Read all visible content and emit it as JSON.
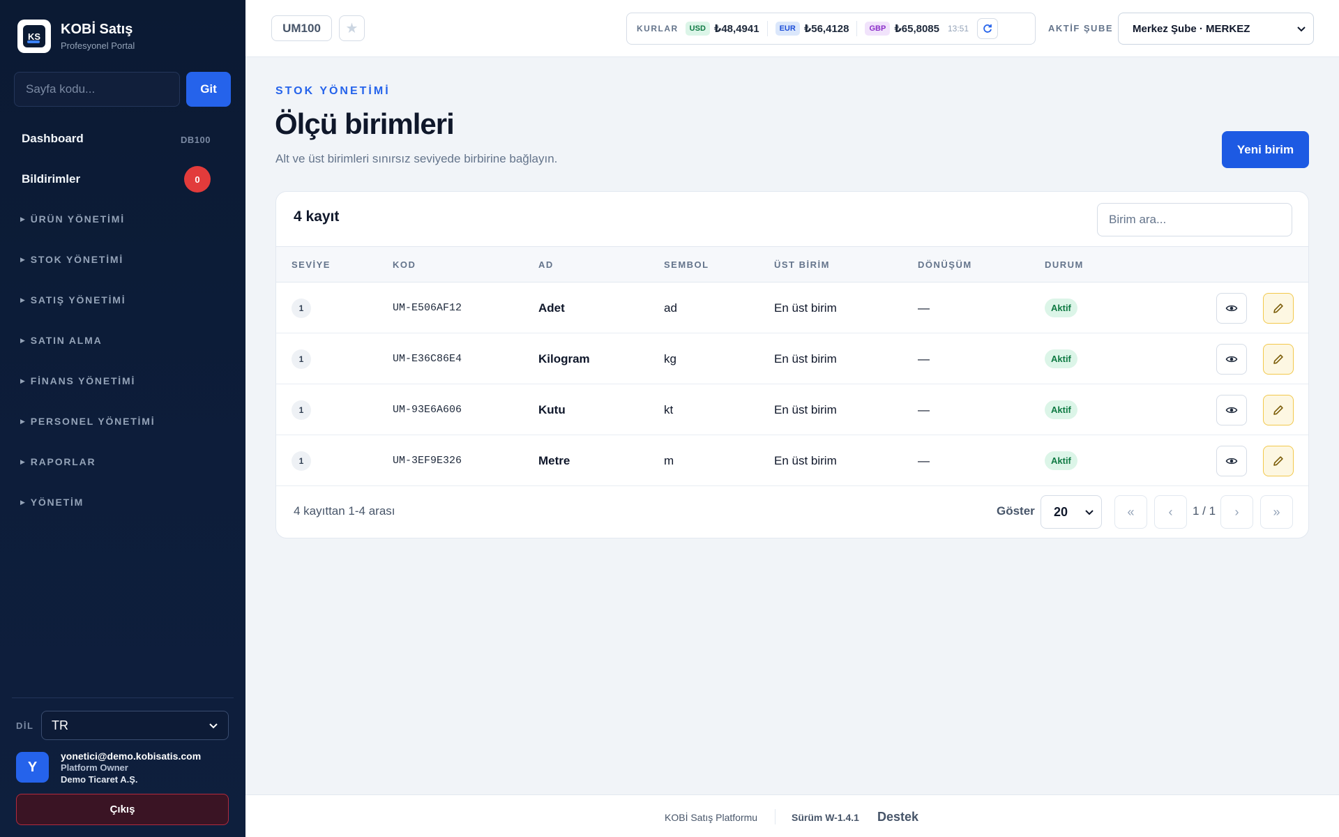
{
  "brand": {
    "title": "KOBİ Satış",
    "subtitle": "Profesyonel Portal"
  },
  "sidebar": {
    "page_code_placeholder": "Sayfa kodu...",
    "go_label": "Git",
    "dashboard": {
      "label": "Dashboard",
      "code": "DB100"
    },
    "notifications": {
      "label": "Bildirimler",
      "count": "0"
    },
    "groups": [
      "ÜRÜN YÖNETİMİ",
      "STOK YÖNETİMİ",
      "SATIŞ YÖNETİMİ",
      "SATIN ALMA",
      "FİNANS YÖNETİMİ",
      "PERSONEL YÖNETİMİ",
      "RAPORLAR",
      "YÖNETİM"
    ],
    "lang_label": "DİL",
    "lang_value": "TR",
    "user": {
      "initial": "Y",
      "email": "yonetici@demo.kobisatis.com",
      "role": "Platform Owner",
      "company": "Demo Ticaret A.Ş."
    },
    "logout_label": "Çıkış"
  },
  "topbar": {
    "page_code": "UM100",
    "rates_label": "KURLAR",
    "rates": [
      {
        "code": "USD",
        "value": "₺48,4941",
        "bg": "#dcf5e8",
        "fg": "#0f7a43"
      },
      {
        "code": "EUR",
        "value": "₺56,4128",
        "bg": "#dbe7fb",
        "fg": "#1d4ed8"
      },
      {
        "code": "GBP",
        "value": "₺65,8085",
        "bg": "#f1e3fb",
        "fg": "#8b2fc9"
      }
    ],
    "rates_time": "13:51",
    "branch_label": "AKTİF ŞUBE",
    "branch_value": "Merkez Şube · MERKEZ"
  },
  "header": {
    "eyebrow": "STOK YÖNETİMİ",
    "title": "Ölçü birimleri",
    "subtitle": "Alt ve üst birimleri sınırsız seviyede birbirine bağlayın.",
    "new_button": "Yeni birim"
  },
  "table": {
    "count_label": "4 kayıt",
    "search_placeholder": "Birim ara...",
    "columns": [
      "SEVİYE",
      "KOD",
      "AD",
      "SEMBOL",
      "ÜST BİRİM",
      "DÖNÜŞÜM",
      "DURUM"
    ],
    "rows": [
      {
        "level": "1",
        "code": "UM-E506AF12",
        "name": "Adet",
        "symbol": "ad",
        "parent": "En üst birim",
        "conversion": "—",
        "status": "Aktif"
      },
      {
        "level": "1",
        "code": "UM-E36C86E4",
        "name": "Kilogram",
        "symbol": "kg",
        "parent": "En üst birim",
        "conversion": "—",
        "status": "Aktif"
      },
      {
        "level": "1",
        "code": "UM-93E6A606",
        "name": "Kutu",
        "symbol": "kt",
        "parent": "En üst birim",
        "conversion": "—",
        "status": "Aktif"
      },
      {
        "level": "1",
        "code": "UM-3EF9E326",
        "name": "Metre",
        "symbol": "m",
        "parent": "En üst birim",
        "conversion": "—",
        "status": "Aktif"
      }
    ],
    "range_label": "4 kayıttan 1-4 arası",
    "show_label": "Göster",
    "page_size": "20",
    "page_info": "1 / 1",
    "pager": {
      "first": "«",
      "prev": "‹",
      "next": "›",
      "last": "»"
    }
  },
  "footer": {
    "platform": "KOBİ Satış Platformu",
    "version": "Sürüm W-1.4.1",
    "support": "Destek"
  },
  "colors": {
    "accent": "#2563eb",
    "sidebar_bg": "#0b1a33",
    "badge": "#e23b3b",
    "status_active": "#0f7a43"
  }
}
